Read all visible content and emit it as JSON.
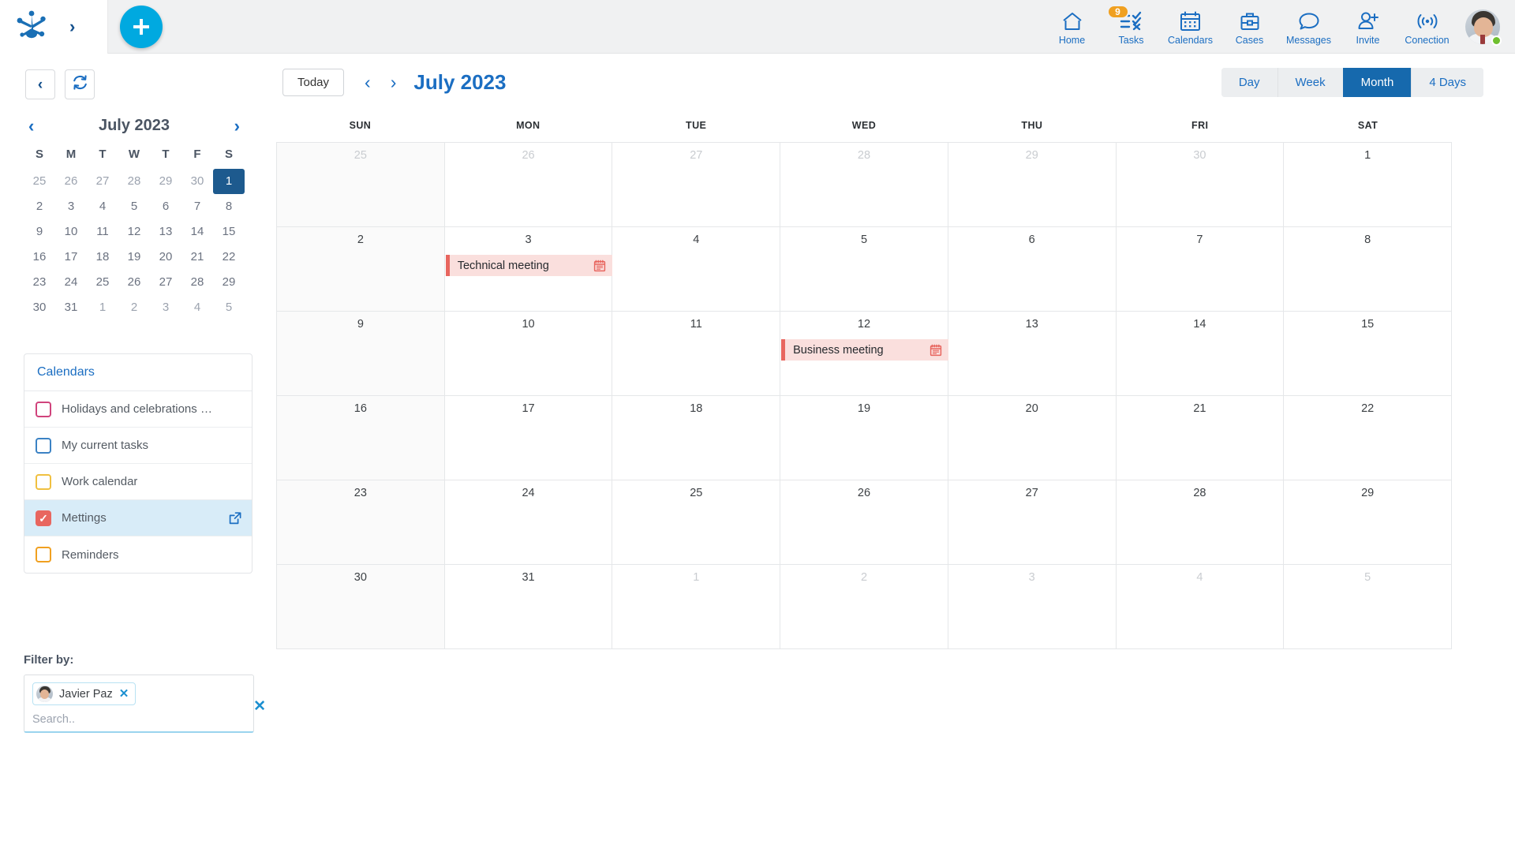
{
  "topbar": {
    "logo_name": "app-logo",
    "expand_chevron": "›",
    "add_button_label": "+",
    "nav": [
      {
        "label": "Home",
        "icon": "home-icon",
        "badge": null
      },
      {
        "label": "Tasks",
        "icon": "tasks-icon",
        "badge": "9"
      },
      {
        "label": "Calendars",
        "icon": "calendar-icon",
        "badge": null
      },
      {
        "label": "Cases",
        "icon": "briefcase-icon",
        "badge": null
      },
      {
        "label": "Messages",
        "icon": "chat-bubble-icon",
        "badge": null
      },
      {
        "label": "Invite",
        "icon": "add-user-icon",
        "badge": null
      },
      {
        "label": "Conection",
        "icon": "broadcast-icon",
        "badge": null
      }
    ],
    "avatar_status": "online"
  },
  "sidebar": {
    "back_button": "‹",
    "refresh_button": "refresh",
    "mini_calendar": {
      "title": "July 2023",
      "prev": "‹",
      "next": "›",
      "dow": [
        "S",
        "M",
        "T",
        "W",
        "T",
        "F",
        "S"
      ],
      "selected_day": 1,
      "weeks": [
        [
          {
            "n": "25",
            "out": true
          },
          {
            "n": "26",
            "out": true
          },
          {
            "n": "27",
            "out": true
          },
          {
            "n": "28",
            "out": true
          },
          {
            "n": "29",
            "out": true
          },
          {
            "n": "30",
            "out": true
          },
          {
            "n": "1",
            "out": false,
            "sel": true
          }
        ],
        [
          {
            "n": "2",
            "out": false
          },
          {
            "n": "3",
            "out": false
          },
          {
            "n": "4",
            "out": false
          },
          {
            "n": "5",
            "out": false
          },
          {
            "n": "6",
            "out": false
          },
          {
            "n": "7",
            "out": false
          },
          {
            "n": "8",
            "out": false
          }
        ],
        [
          {
            "n": "9",
            "out": false
          },
          {
            "n": "10",
            "out": false
          },
          {
            "n": "11",
            "out": false
          },
          {
            "n": "12",
            "out": false
          },
          {
            "n": "13",
            "out": false
          },
          {
            "n": "14",
            "out": false
          },
          {
            "n": "15",
            "out": false
          }
        ],
        [
          {
            "n": "16",
            "out": false
          },
          {
            "n": "17",
            "out": false
          },
          {
            "n": "18",
            "out": false
          },
          {
            "n": "19",
            "out": false
          },
          {
            "n": "20",
            "out": false
          },
          {
            "n": "21",
            "out": false
          },
          {
            "n": "22",
            "out": false
          }
        ],
        [
          {
            "n": "23",
            "out": false
          },
          {
            "n": "24",
            "out": false
          },
          {
            "n": "25",
            "out": false
          },
          {
            "n": "26",
            "out": false
          },
          {
            "n": "27",
            "out": false
          },
          {
            "n": "28",
            "out": false
          },
          {
            "n": "29",
            "out": false
          }
        ],
        [
          {
            "n": "30",
            "out": false
          },
          {
            "n": "31",
            "out": false
          },
          {
            "n": "1",
            "out": true
          },
          {
            "n": "2",
            "out": true
          },
          {
            "n": "3",
            "out": true
          },
          {
            "n": "4",
            "out": true
          },
          {
            "n": "5",
            "out": true
          }
        ]
      ]
    },
    "calendars_card": {
      "title": "Calendars",
      "items": [
        {
          "label": "Holidays and celebrations of A…",
          "color": "#d0437c",
          "checked": false,
          "active": false,
          "external_link": false
        },
        {
          "label": "My current tasks",
          "color": "#3b82c4",
          "checked": false,
          "active": false,
          "external_link": false
        },
        {
          "label": "Work calendar",
          "color": "#f0c040",
          "checked": false,
          "active": false,
          "external_link": false
        },
        {
          "label": "Mettings",
          "color": "#e8665f",
          "checked": true,
          "active": true,
          "external_link": true
        },
        {
          "label": "Reminders",
          "color": "#f0a020",
          "checked": false,
          "active": false,
          "external_link": false
        }
      ]
    },
    "filter": {
      "label": "Filter by:",
      "chip_name": "Javier Paz",
      "chip_remove": "✕",
      "search_placeholder": "Search..",
      "search_value": "",
      "clear_all": "✕"
    }
  },
  "main": {
    "toolbar": {
      "today_label": "Today",
      "prev_arrow": "‹",
      "next_arrow": "›",
      "month_title": "July 2023",
      "views": [
        {
          "label": "Day",
          "active": false
        },
        {
          "label": "Week",
          "active": false
        },
        {
          "label": "Month",
          "active": true
        },
        {
          "label": "4 Days",
          "active": false
        }
      ]
    },
    "grid": {
      "dow": [
        "SUN",
        "MON",
        "TUE",
        "WED",
        "THU",
        "FRI",
        "SAT"
      ],
      "weeks": [
        [
          {
            "n": "25",
            "out": true
          },
          {
            "n": "26",
            "out": true
          },
          {
            "n": "27",
            "out": true
          },
          {
            "n": "28",
            "out": true
          },
          {
            "n": "29",
            "out": true
          },
          {
            "n": "30",
            "out": true
          },
          {
            "n": "1",
            "out": false
          }
        ],
        [
          {
            "n": "2",
            "out": false
          },
          {
            "n": "3",
            "out": false,
            "event": {
              "title": "Technical meeting",
              "color": "#e8665f",
              "bg": "#fadfdd",
              "icon": "event-calendar-icon"
            }
          },
          {
            "n": "4",
            "out": false
          },
          {
            "n": "5",
            "out": false
          },
          {
            "n": "6",
            "out": false
          },
          {
            "n": "7",
            "out": false
          },
          {
            "n": "8",
            "out": false
          }
        ],
        [
          {
            "n": "9",
            "out": false
          },
          {
            "n": "10",
            "out": false
          },
          {
            "n": "11",
            "out": false
          },
          {
            "n": "12",
            "out": false,
            "event": {
              "title": "Business meeting",
              "color": "#e8665f",
              "bg": "#fadfdd",
              "icon": "event-calendar-icon"
            }
          },
          {
            "n": "13",
            "out": false
          },
          {
            "n": "14",
            "out": false
          },
          {
            "n": "15",
            "out": false
          }
        ],
        [
          {
            "n": "16",
            "out": false
          },
          {
            "n": "17",
            "out": false
          },
          {
            "n": "18",
            "out": false
          },
          {
            "n": "19",
            "out": false
          },
          {
            "n": "20",
            "out": false
          },
          {
            "n": "21",
            "out": false
          },
          {
            "n": "22",
            "out": false
          }
        ],
        [
          {
            "n": "23",
            "out": false
          },
          {
            "n": "24",
            "out": false
          },
          {
            "n": "25",
            "out": false
          },
          {
            "n": "26",
            "out": false
          },
          {
            "n": "27",
            "out": false
          },
          {
            "n": "28",
            "out": false
          },
          {
            "n": "29",
            "out": false
          }
        ],
        [
          {
            "n": "30",
            "out": false
          },
          {
            "n": "31",
            "out": false
          },
          {
            "n": "1",
            "out": true
          },
          {
            "n": "2",
            "out": true
          },
          {
            "n": "3",
            "out": true
          },
          {
            "n": "4",
            "out": true
          },
          {
            "n": "5",
            "out": true
          }
        ]
      ]
    }
  },
  "colors": {
    "accent_blue": "#1b6ec2",
    "active_blue": "#1669ad",
    "add_button": "#00a9e0",
    "badge_orange": "#f0a020",
    "event_red": "#e8665f",
    "event_bg": "#fadfdd",
    "selected_day": "#1d5a8e",
    "row_highlight": "#d8ecf8"
  }
}
